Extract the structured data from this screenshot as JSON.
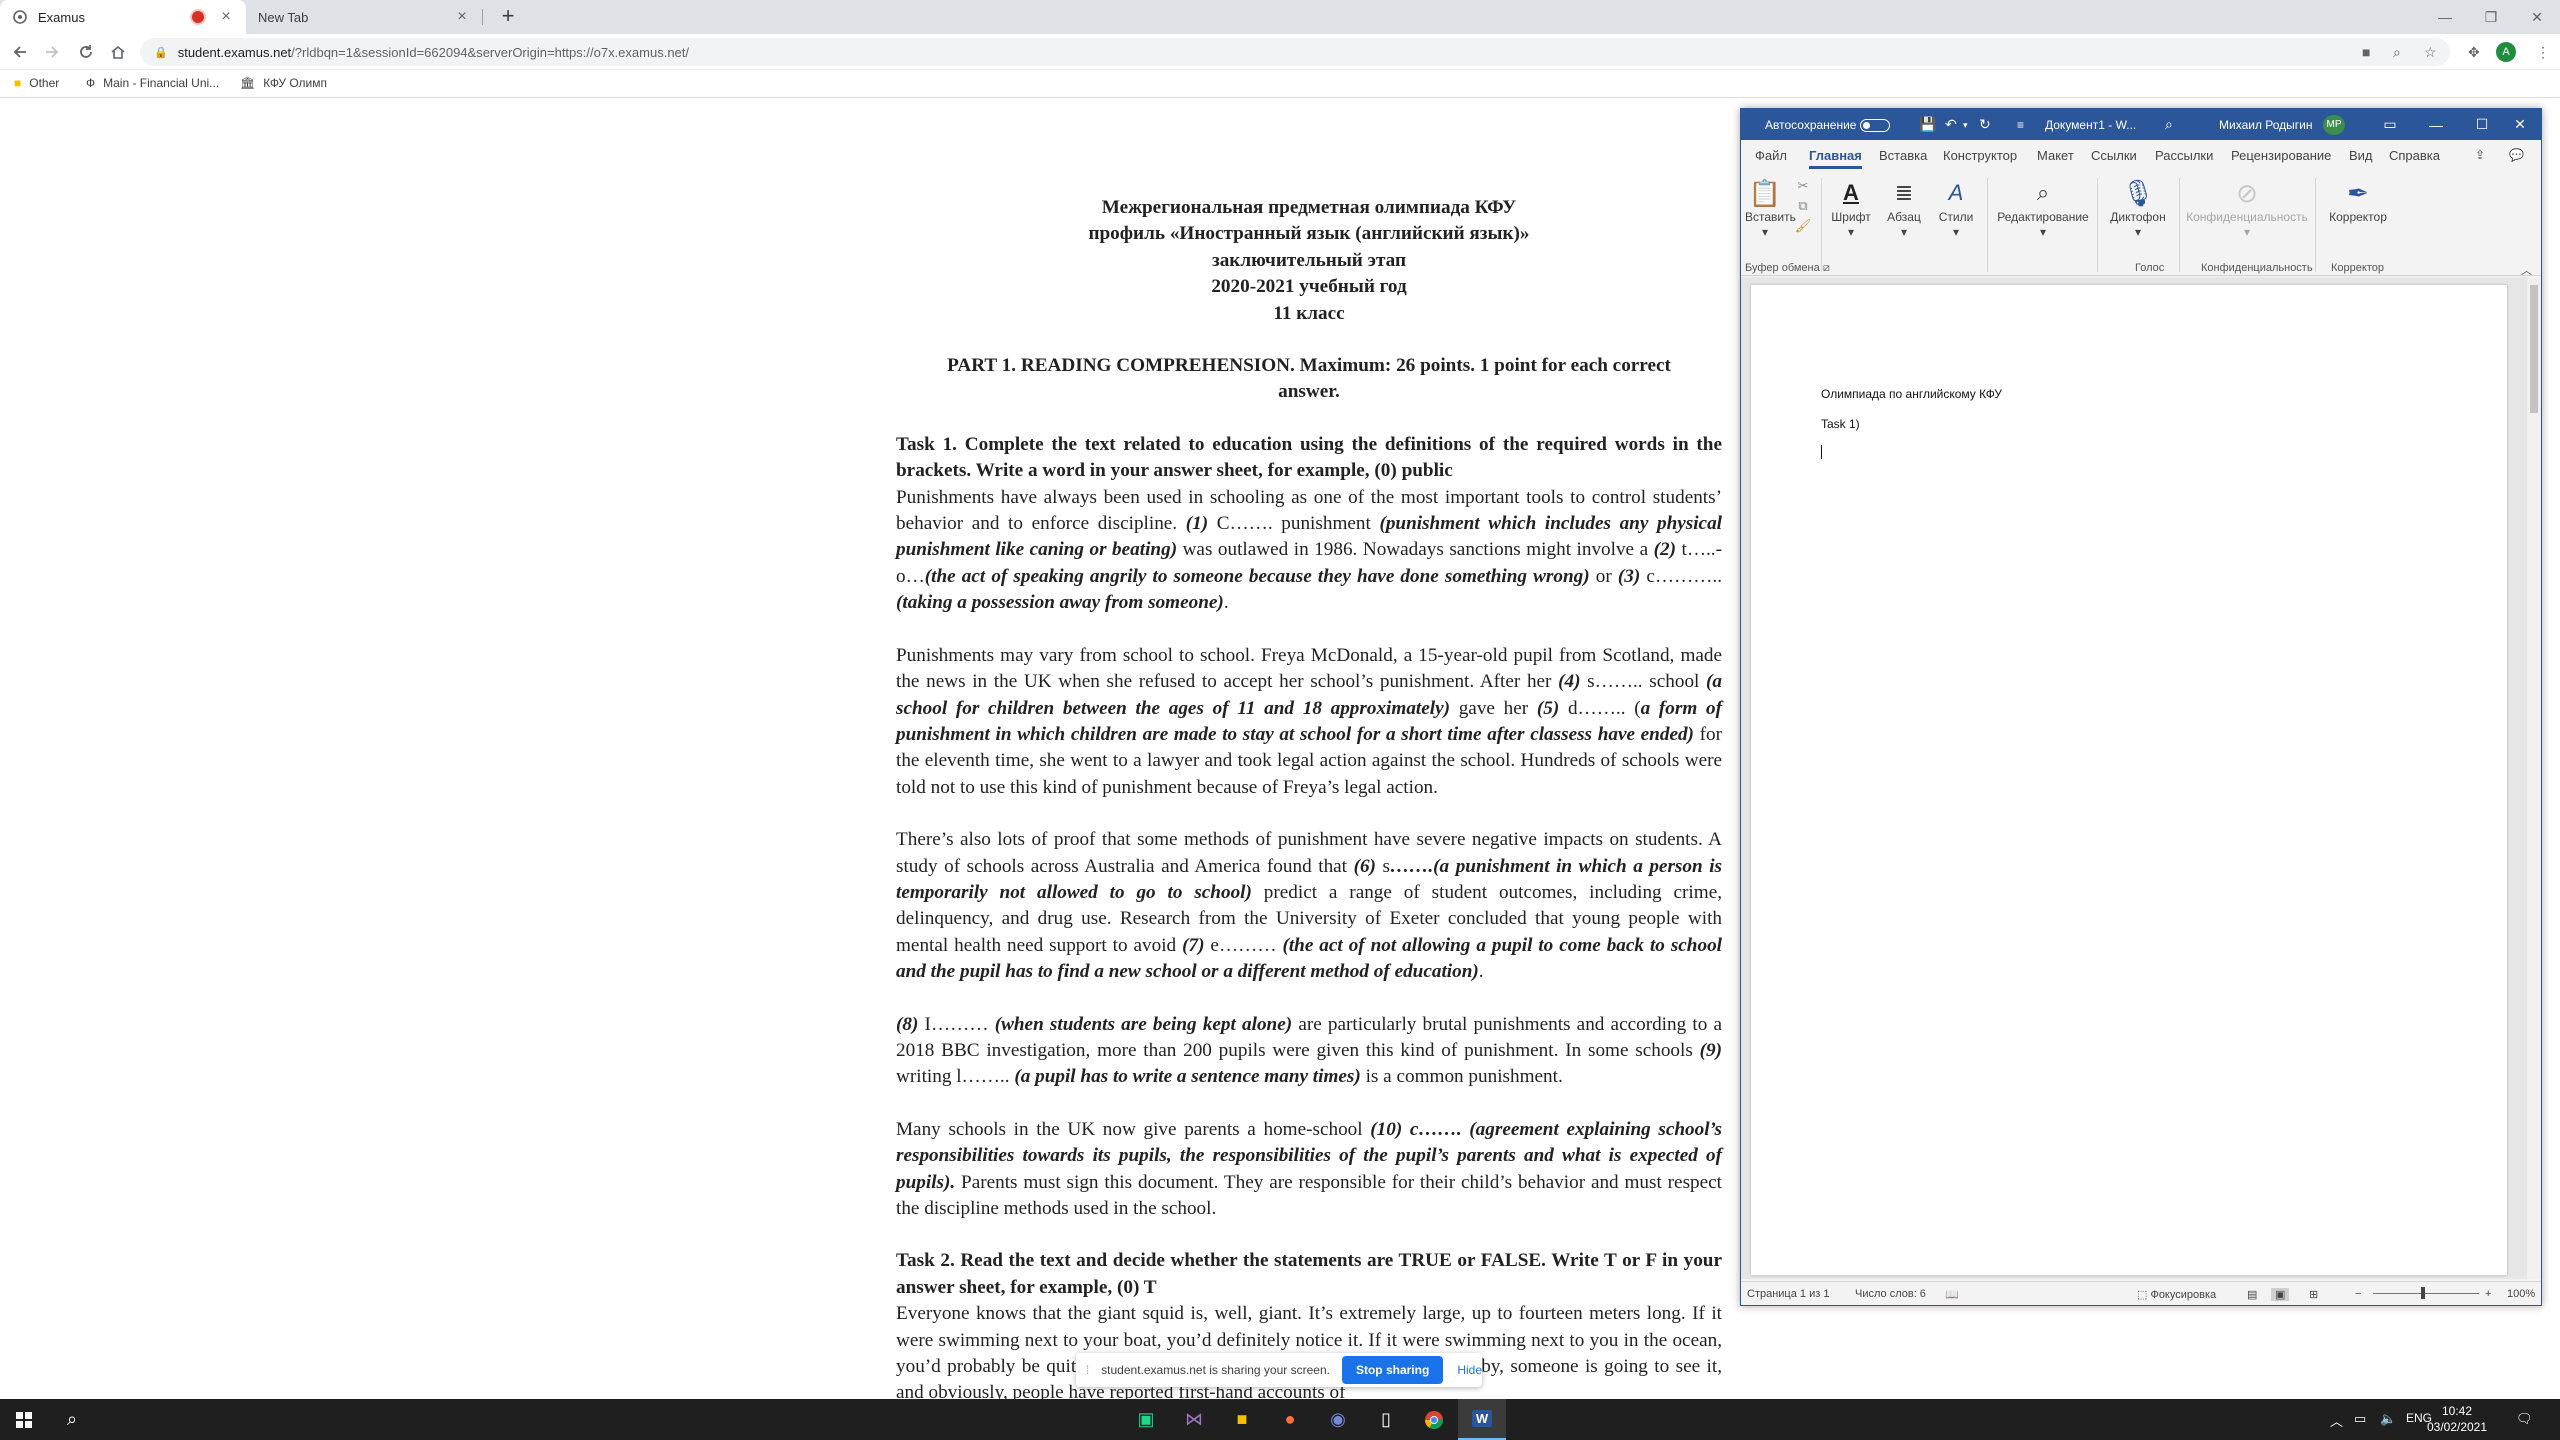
{
  "browser": {
    "tabs": [
      {
        "title": "Examus",
        "recording": true
      },
      {
        "title": "New Tab"
      }
    ],
    "url_host": "student.examus.net",
    "url_path": "/?rldbqn=1&sessionId=662094&serverOrigin=https://o7x.examus.net/",
    "bookmarks": [
      "Other",
      "Main - Financial Uni...",
      "КФУ Олимп"
    ],
    "profile_initial": "A",
    "colors": {
      "tabstrip": "#dee1e6",
      "accent": "#1a73e8",
      "recording": "#d93025"
    }
  },
  "document": {
    "header_lines": [
      "Межрегиональная предметная олимпиада КФУ",
      "профиль «Иностранный язык (английский язык)»",
      "заключительный этап",
      "2020-2021 учебный год",
      "11 класс"
    ],
    "part1": "PART 1. READING COMPREHENSION. Maximum: 26 points. 1 point for each correct answer.",
    "task1_heading": "Task 1. Complete the text related to education using the definitions of the required words in the brackets. Write a word in your answer sheet, for example, (0) public",
    "p1": [
      {
        "t": "Punishments have always been used in schooling as one of the most important tools to control students’ behavior and to enforce discipline. ",
        "s": ""
      },
      {
        "t": "(1)",
        "s": "bi"
      },
      {
        "t": " C…….  punishment ",
        "s": ""
      },
      {
        "t": "(punishment which includes any physical punishment like caning or beating)",
        "s": "bi"
      },
      {
        "t": " was outlawed in 1986. Nowadays sanctions might involve a ",
        "s": ""
      },
      {
        "t": "(2)",
        "s": "bi"
      },
      {
        "t": " t…..-o…",
        "s": ""
      },
      {
        "t": "(the act of speaking angrily to someone because they have done something wrong)",
        "s": "bi"
      },
      {
        "t": " or ",
        "s": ""
      },
      {
        "t": "(3)",
        "s": "bi"
      },
      {
        "t": " c……….. ",
        "s": ""
      },
      {
        "t": "(taking a possession away from someone)",
        "s": "bi"
      },
      {
        "t": ".",
        "s": ""
      }
    ],
    "p2": [
      {
        "t": "Punishments may vary from school to school. Freya McDonald, a 15-year-old pupil from Scotland, made the news in the UK when she refused to accept her school’s punishment. After her ",
        "s": ""
      },
      {
        "t": "(4)",
        "s": "bi"
      },
      {
        "t": " s…….. school ",
        "s": ""
      },
      {
        "t": "(a school for children between the ages of 11 and 18 approximately)",
        "s": "bi"
      },
      {
        "t": "  gave her ",
        "s": ""
      },
      {
        "t": "(5)",
        "s": "bi"
      },
      {
        "t": " d…….. (",
        "s": ""
      },
      {
        "t": "a form of punishment in which children are made to stay at school for a short time after classess have ended)",
        "s": "bi"
      },
      {
        "t": " for the eleventh time, she went to a lawyer and took legal action against the school. Hundreds of schools were told not to use this kind of punishment because of Freya’s legal action.",
        "s": ""
      }
    ],
    "p3": [
      {
        "t": "There’s also lots of proof that some methods of punishment have severe negative impacts on students. A study of schools across Australia and America found that ",
        "s": ""
      },
      {
        "t": "(6)",
        "s": "bi"
      },
      {
        "t": " s",
        "s": ""
      },
      {
        "t": "…….(a punishment in which a person is temporarily not allowed to go to school)",
        "s": "bi"
      },
      {
        "t": "   predict a range of student outcomes, including crime, delinquency, and drug use. Research from the University of Exeter concluded that young people with mental health need support to avoid ",
        "s": ""
      },
      {
        "t": "(7)",
        "s": "bi"
      },
      {
        "t": " e……… ",
        "s": ""
      },
      {
        "t": "(the act of not allowing a pupil to come back to school and the pupil has to find a new school or a different method of education)",
        "s": "bi"
      },
      {
        "t": ".",
        "s": ""
      }
    ],
    "p4": [
      {
        "t": "(8)",
        "s": "bi"
      },
      {
        "t": " I……… ",
        "s": ""
      },
      {
        "t": "(when students are being kept alone)",
        "s": "bi"
      },
      {
        "t": " are particularly brutal punishments and according to a 2018 BBC investigation, more than 200 pupils were given this kind of punishment. In some schools ",
        "s": ""
      },
      {
        "t": "(9)",
        "s": "bi"
      },
      {
        "t": " writing l…….. ",
        "s": ""
      },
      {
        "t": "(a pupil has to write a sentence many times)",
        "s": "bi"
      },
      {
        "t": " is a common punishment.",
        "s": ""
      }
    ],
    "p5": [
      {
        "t": "Many schools in the UK now give parents a home-school ",
        "s": ""
      },
      {
        "t": "(10) c……. (agreement explaining school’s responsibilities towards its pupils, the responsibilities of the pupil’s parents and what is expected of pupils).",
        "s": "bi"
      },
      {
        "t": " Parents must sign this document. They are responsible for their child’s behavior and must respect the discipline methods used in the school.",
        "s": ""
      }
    ],
    "task2_heading": "Task 2. Read the text and decide whether the statements are TRUE or FALSE. Write T or F in your answer sheet, for example, (0) T",
    "p6": "Everyone knows that the giant squid is, well, giant. It’s extremely large, up to fourteen meters long. If it were swimming next to your boat, you’d definitely notice it. If it were swimming next to you in the ocean, you’d probably be quite terrified. In any case, if there’s a giant squid nearby, someone is going to see it, and obviously, people have reported first-hand accounts of"
  },
  "word": {
    "autosave_label": "Автосохранение",
    "doc_title": "Документ1 - W...",
    "user_name": "Михаил Родыгин",
    "user_initials": "MP",
    "tabs": [
      "Файл",
      "Главная",
      "Вставка",
      "Конструктор",
      "Макет",
      "Ссылки",
      "Рассылки",
      "Рецензирование",
      "Вид",
      "Справка"
    ],
    "active_tab": "Главная",
    "ribbon": {
      "paste": "Вставить",
      "font": "Шрифт",
      "paragraph": "Абзац",
      "styles": "Стили",
      "editing": "Редактирование",
      "dictate": "Диктофон",
      "sensitivity": "Конфиденциальность",
      "editor": "Корректор"
    },
    "group_labels": {
      "clipboard": "Буфер обмена",
      "voice": "Голос",
      "sensitivity": "Конфиденциальность",
      "editor": "Корректор"
    },
    "content_lines": [
      "Олимпиада по английскому КФУ",
      "Task 1)"
    ],
    "status": {
      "page": "Страница 1 из 1",
      "words": "Число слов: 6",
      "focus": "Фокусировка",
      "zoom": "100%"
    },
    "colors": {
      "brand": "#2b579a"
    }
  },
  "share_bar": {
    "message": "student.examus.net is sharing your screen.",
    "stop": "Stop sharing",
    "hide": "Hide"
  },
  "taskbar": {
    "lang": "ENG",
    "time": "10:42",
    "date": "03/02/2021"
  }
}
